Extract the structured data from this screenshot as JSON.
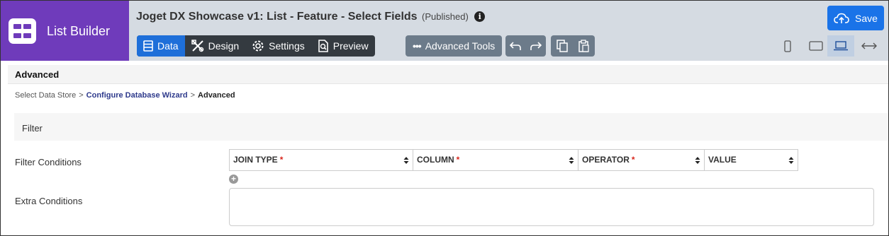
{
  "brand": {
    "title": "List Builder"
  },
  "header": {
    "app_title": "Joget DX Showcase v1: List - Feature - Select Fields",
    "status": "(Published)",
    "info_glyph": "i"
  },
  "tabs": [
    {
      "label": "Data",
      "icon": "list-icon",
      "active": true
    },
    {
      "label": "Design",
      "icon": "design-tools-icon",
      "active": false
    },
    {
      "label": "Settings",
      "icon": "gear-icon",
      "active": false
    },
    {
      "label": "Preview",
      "icon": "preview-icon",
      "active": false
    }
  ],
  "toolbar": {
    "advanced_tools_label": "Advanced Tools",
    "dots": "•••",
    "save_label": "Save"
  },
  "devices": [
    {
      "name": "phone",
      "active": false
    },
    {
      "name": "tablet",
      "active": false
    },
    {
      "name": "laptop",
      "active": true
    },
    {
      "name": "full-width",
      "active": false
    }
  ],
  "section": {
    "title": "Advanced"
  },
  "breadcrumb": {
    "items": [
      "Select Data Store",
      "Configure Database Wizard",
      "Advanced"
    ],
    "separator": ">"
  },
  "filter": {
    "title": "Filter",
    "conditions_label": "Filter Conditions",
    "columns": [
      {
        "label": "JOIN TYPE",
        "required": true
      },
      {
        "label": "COLUMN",
        "required": true
      },
      {
        "label": "OPERATOR",
        "required": true
      },
      {
        "label": "VALUE",
        "required": false
      }
    ],
    "required_mark": "*",
    "add_glyph": "+",
    "extra_label": "Extra Conditions",
    "extra_value": ""
  },
  "colors": {
    "brand": "#6f3bbb",
    "accent": "#1e6fd9",
    "save": "#1a73e8",
    "required": "#d9261c"
  }
}
